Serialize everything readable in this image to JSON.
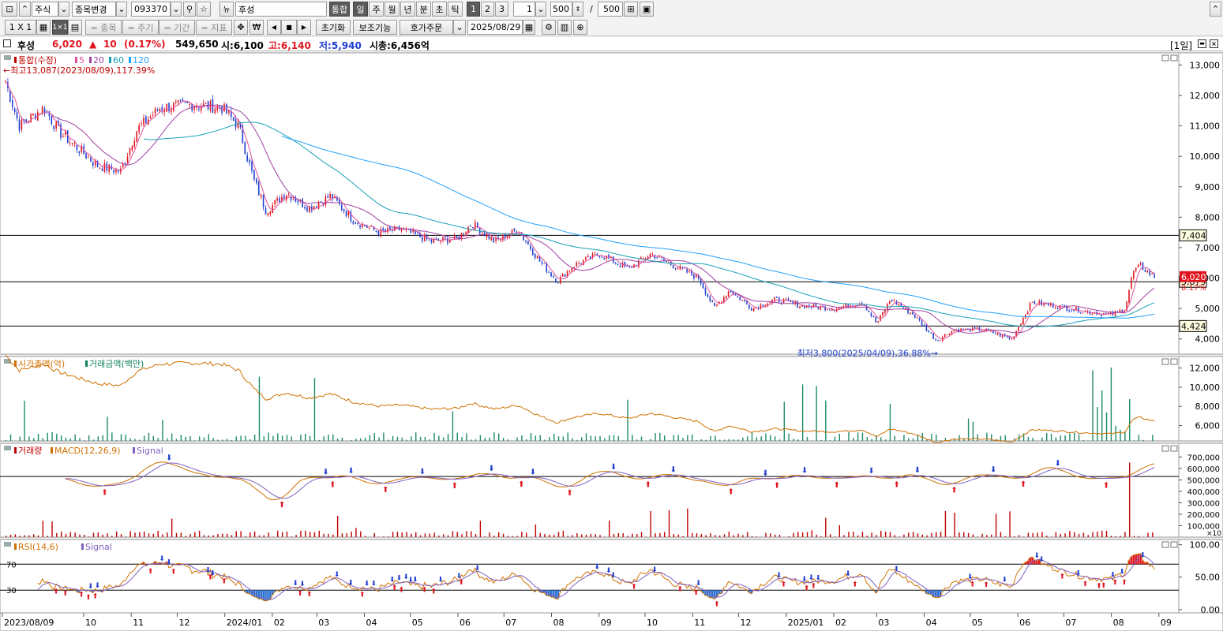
{
  "toolbar": {
    "market": "주식",
    "stock_change": "종목변경",
    "code": "093370",
    "stock_name": "후성",
    "integrated": "통합",
    "periods": [
      "일",
      "주",
      "월",
      "년",
      "분",
      "초",
      "틱"
    ],
    "selected_period": "일",
    "counts": [
      "1",
      "2",
      "3"
    ],
    "interval": "1",
    "display_count": "500",
    "slash": "/",
    "total_count": "500"
  },
  "toolbar2": {
    "layout1": "1 X 1",
    "layout2": "1×1",
    "item_label": "= 종목",
    "cycle_label": "= 주기",
    "period_label": "= 기간",
    "indicator_label": "= 지표",
    "reset": "초기화",
    "assist": "보조기능",
    "order": "호가주문",
    "date": "2025/08/29"
  },
  "info": {
    "name": "후성",
    "price": "6,020",
    "change_sign": "▲",
    "change": "10",
    "change_pct": "(0.17%)",
    "volume": "549,650",
    "open": "시:6,100",
    "high": "고:6,140",
    "low": "저:5,940",
    "mcap": "시총:6,456억",
    "period_badge": "[1일]"
  },
  "chart_data": {
    "type": "candlestick",
    "date_range": [
      "2023/08/09",
      "2025/08/29"
    ],
    "x_ticks": [
      "2023/08/09",
      "10",
      "11",
      "12",
      "2024/01",
      "02",
      "03",
      "04",
      "05",
      "06",
      "07",
      "08",
      "09",
      "10",
      "11",
      "12",
      "2025/01",
      "02",
      "03",
      "04",
      "05",
      "06",
      "07",
      "08",
      "09"
    ],
    "panels": [
      {
        "name": "price",
        "legend": [
          "통합(수정)",
          "5",
          "20",
          "60",
          "120"
        ],
        "legend_colors": [
          "#c00000",
          "#e0509a",
          "#a040a0",
          "#18a0b8",
          "#20a0ff"
        ],
        "y_ticks": [
          4000,
          5000,
          6000,
          7000,
          8000,
          9000,
          10000,
          11000,
          12000,
          13000
        ],
        "y_tick_labels": [
          "4,000",
          "5,000",
          "6,000",
          "7,000",
          "8,000",
          "9,000",
          "10,000",
          "11,000",
          "12,000",
          "13,000"
        ],
        "ylim": [
          3500,
          13400
        ],
        "hlines": [
          {
            "value": 7404,
            "label": "7,404"
          },
          {
            "value": 5879,
            "label": "5,879"
          },
          {
            "value": 4424,
            "label": "4,424"
          }
        ],
        "current": {
          "value": 6020,
          "label": "6,020",
          "pct": "0.17%"
        },
        "annotations": [
          {
            "text": "최고13,087(2023/08/09),117.39%",
            "value": 13087
          },
          {
            "text": "최저3,800(2025/04/09),36.88%",
            "value": 3800
          }
        ],
        "close_keypoints": [
          [
            "2023/08/09",
            12800
          ],
          [
            "2023/08/20",
            11000
          ],
          [
            "2023/09/05",
            11600
          ],
          [
            "2023/09/15",
            10800
          ],
          [
            "2023/10/10",
            9700
          ],
          [
            "2023/10/25",
            9500
          ],
          [
            "2023/11/05",
            10900
          ],
          [
            "2023/11/20",
            11600
          ],
          [
            "2023/12/10",
            11700
          ],
          [
            "2023/12/30",
            11600
          ],
          [
            "2024/01/10",
            11000
          ],
          [
            "2024/01/20",
            9200
          ],
          [
            "2024/01/28",
            8200
          ],
          [
            "2024/02/10",
            8800
          ],
          [
            "2024/02/25",
            8300
          ],
          [
            "2024/03/10",
            8700
          ],
          [
            "2024/03/25",
            7900
          ],
          [
            "2024/04/10",
            7500
          ],
          [
            "2024/04/25",
            7600
          ],
          [
            "2024/05/15",
            7200
          ],
          [
            "2024/06/01",
            7300
          ],
          [
            "2024/06/10",
            7800
          ],
          [
            "2024/06/25",
            7200
          ],
          [
            "2024/07/10",
            7600
          ],
          [
            "2024/07/25",
            6500
          ],
          [
            "2024/08/05",
            5900
          ],
          [
            "2024/08/15",
            6400
          ],
          [
            "2024/09/01",
            6800
          ],
          [
            "2024/09/20",
            6300
          ],
          [
            "2024/10/05",
            6800
          ],
          [
            "2024/10/20",
            6400
          ],
          [
            "2024/11/05",
            6000
          ],
          [
            "2024/11/15",
            5000
          ],
          [
            "2024/11/25",
            5600
          ],
          [
            "2024/12/10",
            5000
          ],
          [
            "2024/12/25",
            5300
          ],
          [
            "2025/01/10",
            5100
          ],
          [
            "2025/02/01",
            5000
          ],
          [
            "2025/02/20",
            5200
          ],
          [
            "2025/03/01",
            4500
          ],
          [
            "2025/03/10",
            5300
          ],
          [
            "2025/03/25",
            4800
          ],
          [
            "2025/04/09",
            3950
          ],
          [
            "2025/04/20",
            4300
          ],
          [
            "2025/05/10",
            4300
          ],
          [
            "2025/05/28",
            4000
          ],
          [
            "2025/06/10",
            5200
          ],
          [
            "2025/06/25",
            5100
          ],
          [
            "2025/07/15",
            4900
          ],
          [
            "2025/08/01",
            4800
          ],
          [
            "2025/08/10",
            5000
          ],
          [
            "2025/08/15",
            6200
          ],
          [
            "2025/08/20",
            6400
          ],
          [
            "2025/08/29",
            6020
          ]
        ]
      },
      {
        "name": "market_cap_value",
        "legend": [
          "시가총액(억)",
          "거래금액(백만)"
        ],
        "legend_colors": [
          "#d07000",
          "#108060"
        ],
        "y_ticks": [
          6000,
          8000,
          10000,
          12000
        ],
        "y_tick_labels": [
          "6,000",
          "8,000",
          "10,000",
          "12,000"
        ],
        "ylim": [
          4400,
          13200
        ]
      },
      {
        "name": "volume_macd",
        "legend": [
          "거래량",
          "MACD(12,26,9)",
          "Signal"
        ],
        "legend_colors": [
          "#c00000",
          "#d07000",
          "#8060c0"
        ],
        "y_ticks": [
          100000,
          200000,
          300000,
          400000,
          500000,
          600000,
          700000
        ],
        "y_tick_labels": [
          "100,000",
          "200,000",
          "300,000",
          "400,000",
          "500,000",
          "600,000",
          "700,000"
        ],
        "y_unit": "×10",
        "ylim": [
          0,
          820000
        ]
      },
      {
        "name": "rsi",
        "legend": [
          "RSI(14,6)",
          "Signal"
        ],
        "legend_colors": [
          "#d07000",
          "#8060c0"
        ],
        "y_ticks": [
          0,
          50,
          100
        ],
        "y_tick_labels": [
          "0.00",
          "50.00",
          "100.00"
        ],
        "levels": [
          70,
          30
        ],
        "ylim": [
          -5,
          108
        ]
      }
    ]
  }
}
